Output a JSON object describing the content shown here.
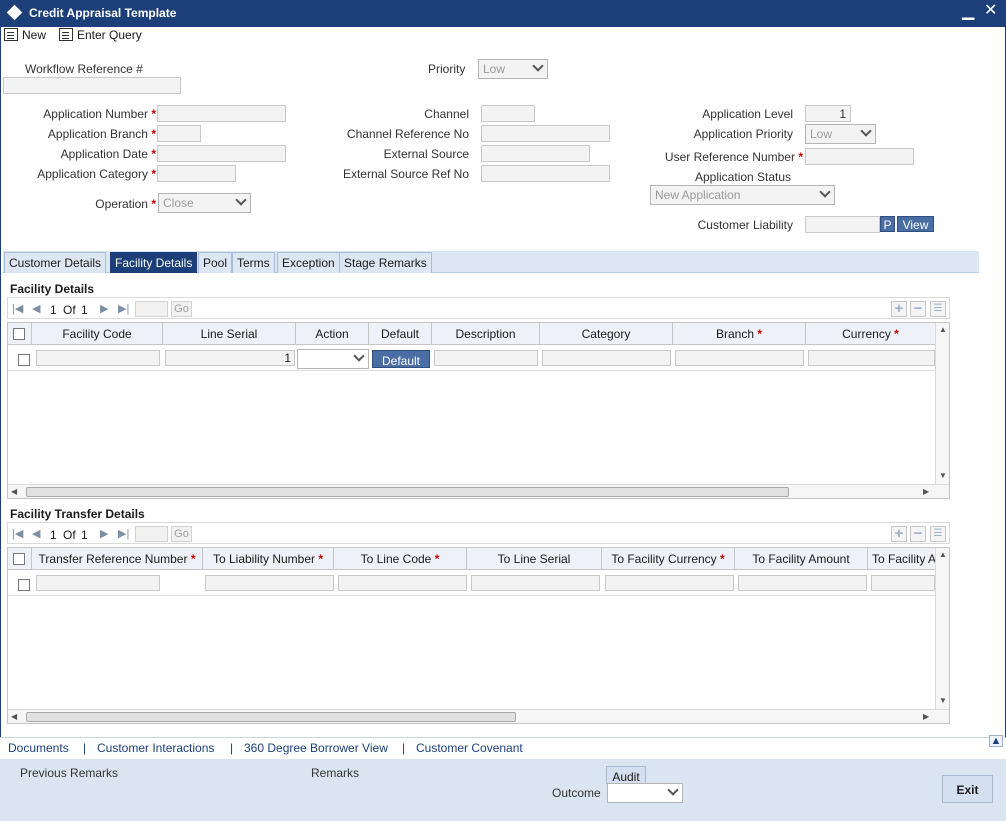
{
  "window": {
    "title": "Credit Appraisal Template"
  },
  "toolbar": {
    "new_label": "New",
    "enter_query_label": "Enter Query"
  },
  "header": {
    "workflow_reference_label": "Workflow Reference #",
    "workflow_reference_value": "",
    "priority_label": "Priority",
    "priority_value": "Low"
  },
  "form": {
    "application_number_label": "Application Number",
    "application_branch_label": "Application Branch",
    "application_date_label": "Application Date",
    "application_category_label": "Application Category",
    "operation_label": "Operation",
    "operation_value": "Close",
    "channel_label": "Channel",
    "channel_reference_label": "Channel Reference No",
    "external_source_label": "External Source",
    "external_source_ref_label": "External Source Ref No",
    "application_level_label": "Application Level",
    "application_level_value": "1",
    "application_priority_label": "Application Priority",
    "application_priority_value": "Low",
    "user_reference_label": "User Reference Number",
    "application_status_label": "Application Status",
    "application_status_value": "New Application",
    "customer_liability_label": "Customer Liability",
    "p_button_label": "P",
    "view_button_label": "View"
  },
  "tabs": [
    {
      "label": "Customer Details"
    },
    {
      "label": "Facility Details"
    },
    {
      "label": "Pool"
    },
    {
      "label": "Terms"
    },
    {
      "label": "Exception"
    },
    {
      "label": "Stage Remarks"
    }
  ],
  "facility_details": {
    "title": "Facility Details",
    "page": "1",
    "of_label": "Of",
    "total_pages": "1",
    "go_label": "Go",
    "columns": [
      "Facility Code",
      "Line Serial",
      "Action",
      "Default",
      "Description",
      "Category",
      "Branch",
      "Currency"
    ],
    "required_columns": [
      "Branch",
      "Currency"
    ],
    "row": {
      "line_serial": "1",
      "default_button": "Default"
    }
  },
  "facility_transfer": {
    "title": "Facility Transfer Details",
    "page": "1",
    "of_label": "Of",
    "total_pages": "1",
    "go_label": "Go",
    "columns": [
      "Transfer Reference Number",
      "To Liability Number",
      "To Line Code",
      "To Line Serial",
      "To Facility Currency",
      "To Facility Amount",
      "To Facility A"
    ]
  },
  "footer": {
    "links": [
      "Documents",
      "Customer Interactions",
      "360 Degree Borrower View",
      "Customer Covenant"
    ],
    "separator": "|",
    "previous_remarks_label": "Previous Remarks",
    "remarks_label": "Remarks",
    "audit_label": "Audit",
    "outcome_label": "Outcome",
    "exit_label": "Exit"
  },
  "colors": {
    "title_bar": "#1c3f79",
    "tab_active": "#1c3f79",
    "required": "#cc0000",
    "footer_bg": "#dbe5f1"
  },
  "icons": [
    "diamond-icon",
    "minimize-icon",
    "close-icon",
    "new-icon",
    "enter-query-icon",
    "first-page-icon",
    "prev-page-icon",
    "next-page-icon",
    "last-page-icon",
    "add-row-icon",
    "delete-row-icon",
    "single-view-icon",
    "collapse-icon"
  ]
}
